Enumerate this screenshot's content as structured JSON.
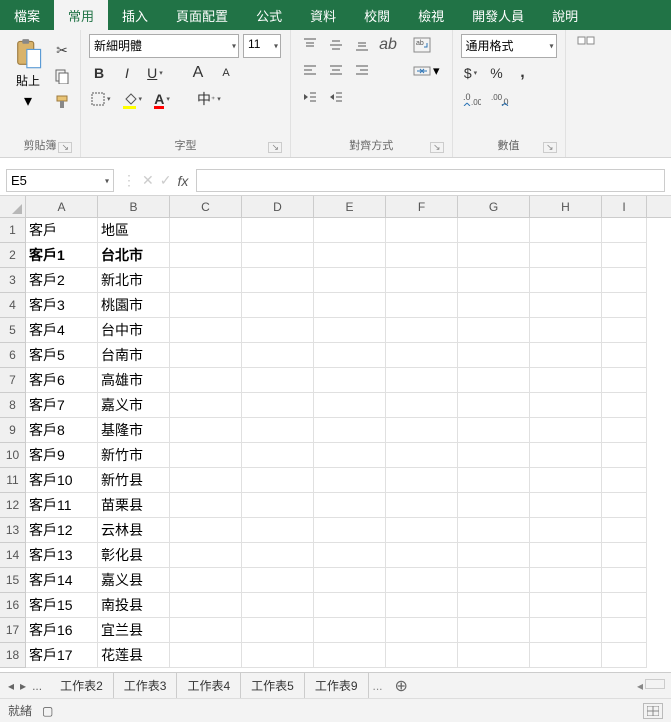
{
  "tabs": {
    "file": "檔案",
    "home": "常用",
    "insert": "插入",
    "layout": "頁面配置",
    "formulas": "公式",
    "data": "資料",
    "review": "校閱",
    "view": "檢視",
    "developer": "開發人員",
    "help": "說明"
  },
  "groups": {
    "clipboard": "剪貼簿",
    "font": "字型",
    "alignment": "對齊方式",
    "number": "數值"
  },
  "clipboard": {
    "paste": "貼上"
  },
  "font": {
    "name": "新細明體",
    "size": "11",
    "bold": "B",
    "italic": "I",
    "underline": "U",
    "grow": "A",
    "shrink": "A",
    "phonetic": "中"
  },
  "number": {
    "format": "通用格式",
    "currency": "$",
    "percent": "%",
    "comma": ",",
    "inc": "",
    "dec": ""
  },
  "namebox": "E5",
  "fx": "fx",
  "columns": [
    "A",
    "B",
    "C",
    "D",
    "E",
    "F",
    "G",
    "H",
    "I"
  ],
  "rows": [
    {
      "n": "1",
      "a": "客戶",
      "b": "地區",
      "bold": false
    },
    {
      "n": "2",
      "a": "客戶1",
      "b": "台北市",
      "bold": true
    },
    {
      "n": "3",
      "a": "客戶2",
      "b": "新北市",
      "bold": false
    },
    {
      "n": "4",
      "a": "客戶3",
      "b": "桃園市",
      "bold": false
    },
    {
      "n": "5",
      "a": "客戶4",
      "b": "台中市",
      "bold": false
    },
    {
      "n": "6",
      "a": "客戶5",
      "b": "台南市",
      "bold": false
    },
    {
      "n": "7",
      "a": "客戶6",
      "b": "高雄市",
      "bold": false
    },
    {
      "n": "8",
      "a": "客戶7",
      "b": "嘉义市",
      "bold": false
    },
    {
      "n": "9",
      "a": "客戶8",
      "b": "基隆市",
      "bold": false
    },
    {
      "n": "10",
      "a": "客戶9",
      "b": "新竹市",
      "bold": false
    },
    {
      "n": "11",
      "a": "客戶10",
      "b": "新竹县",
      "bold": false
    },
    {
      "n": "12",
      "a": "客戶11",
      "b": "苗栗县",
      "bold": false
    },
    {
      "n": "13",
      "a": "客戶12",
      "b": "云林县",
      "bold": false
    },
    {
      "n": "14",
      "a": "客戶13",
      "b": "彰化县",
      "bold": false
    },
    {
      "n": "15",
      "a": "客戶14",
      "b": "嘉义县",
      "bold": false
    },
    {
      "n": "16",
      "a": "客戶15",
      "b": "南投县",
      "bold": false
    },
    {
      "n": "17",
      "a": "客戶16",
      "b": "宜兰县",
      "bold": false
    },
    {
      "n": "18",
      "a": "客戶17",
      "b": "花莲县",
      "bold": false
    }
  ],
  "sheets": [
    "工作表2",
    "工作表3",
    "工作表4",
    "工作表5",
    "工作表9"
  ],
  "sheet_more": "...",
  "status": {
    "ready": "就緒"
  }
}
